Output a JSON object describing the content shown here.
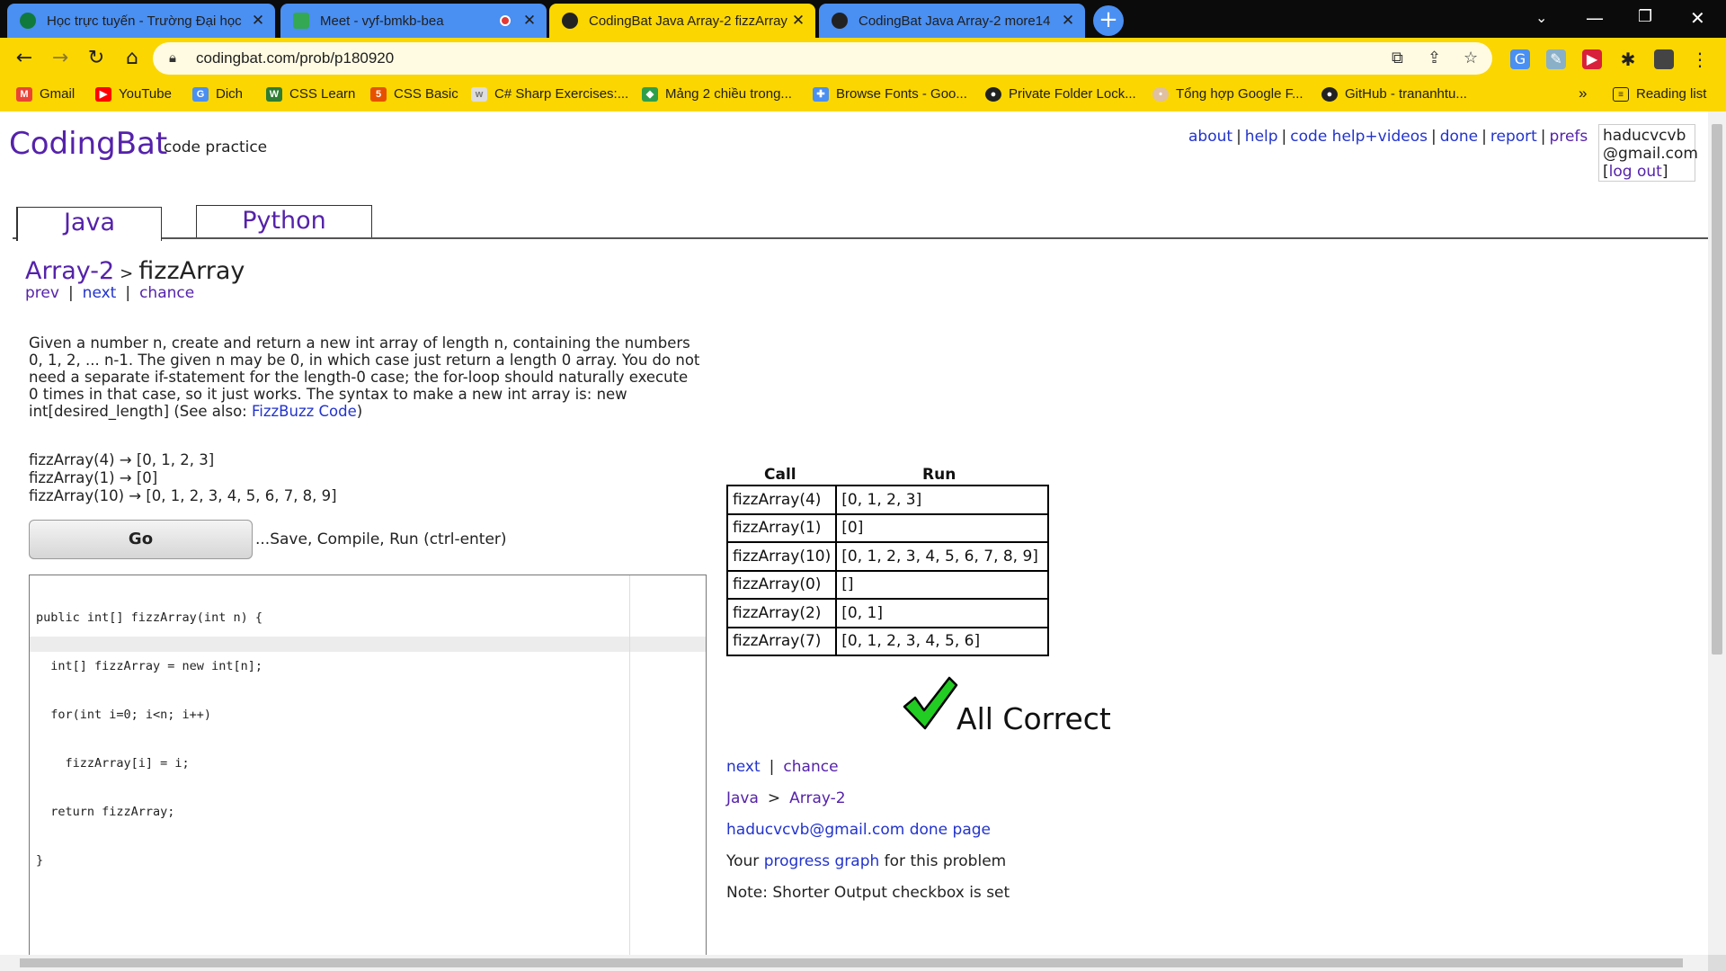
{
  "browser": {
    "tabs": [
      {
        "label": "Học trực tuyến - Trường Đại học",
        "close": "✕"
      },
      {
        "label": "Meet - vyf-bmkb-bea",
        "close": "✕"
      },
      {
        "label": "CodingBat Java Array-2 fizzArray",
        "close": "✕"
      },
      {
        "label": "CodingBat Java Array-2 more14",
        "close": "✕"
      }
    ],
    "new_tab": "+",
    "url": "codingbat.com/prob/p180920",
    "bookmarks": [
      {
        "label": "Gmail"
      },
      {
        "label": "YouTube"
      },
      {
        "label": "Dich"
      },
      {
        "label": "CSS Learn"
      },
      {
        "label": "CSS Basic"
      },
      {
        "label": "C# Sharp Exercises:..."
      },
      {
        "label": "Mảng 2 chiều trong..."
      },
      {
        "label": "Browse Fonts - Goo..."
      },
      {
        "label": "Private Folder Lock..."
      },
      {
        "label": "Tổng hợp Google F..."
      },
      {
        "label": "GitHub - trananhtu..."
      }
    ],
    "bookmarks_more": "»",
    "reading_list": "Reading list"
  },
  "site": {
    "logo": "CodingBat",
    "logo_sub": "code practice",
    "top_links": [
      "about",
      "help",
      "code help+videos",
      "done",
      "report",
      "prefs"
    ],
    "user": {
      "line1": "haducvcvb",
      "line2": "@gmail.com",
      "logout_open": "[",
      "logout": "log out",
      "logout_close": "]"
    },
    "lang_tabs": [
      "Java",
      "Python"
    ]
  },
  "problem": {
    "category": "Array-2",
    "separator": ">",
    "name": "fizzArray",
    "nav": [
      "prev",
      "next",
      "chance"
    ],
    "description": "Given a number n, create and return a new int array of length n, containing the numbers 0, 1, 2, ... n-1. The given n may be 0, in which case just return a length 0 array. You do not need a separate if-statement for the length-0 case; the for-loop should naturally execute 0 times in that case, so it just works. The syntax to make a new int array is: new int[desired_length]   (See also: ",
    "see_also_link": "FizzBuzz Code",
    "see_also_close": ")",
    "examples": [
      "fizzArray(4) → [0, 1, 2, 3]",
      "fizzArray(1) → [0]",
      "fizzArray(10) → [0, 1, 2, 3, 4, 5, 6, 7, 8, 9]"
    ],
    "go_label": "Go",
    "go_hint": "...Save, Compile, Run (ctrl-enter)"
  },
  "editor": {
    "code_lines": [
      "public int[] fizzArray(int n) {",
      "  int[] fizzArray = new int[n];",
      "  for(int i=0; i<n; i++)",
      "    fizzArray[i] = i;",
      "  return fizzArray;",
      "}"
    ]
  },
  "results": {
    "col_call": "Call",
    "col_run": "Run",
    "rows": [
      {
        "call": "fizzArray(4)",
        "run": "[0, 1, 2, 3]"
      },
      {
        "call": "fizzArray(1)",
        "run": "[0]"
      },
      {
        "call": "fizzArray(10)",
        "run": "[0, 1, 2, 3, 4, 5, 6, 7, 8, 9]"
      },
      {
        "call": "fizzArray(0)",
        "run": "[]"
      },
      {
        "call": "fizzArray(2)",
        "run": "[0, 1]"
      },
      {
        "call": "fizzArray(7)",
        "run": "[0, 1, 2, 3, 4, 5, 6]"
      }
    ],
    "status": "All Correct",
    "check_icon": "check-mark-icon"
  },
  "after": {
    "nav": [
      "next",
      "chance"
    ],
    "crumb": [
      "Java",
      ">",
      "Array-2"
    ],
    "done_page": "haducvcvb@gmail.com done page",
    "progress_prefix": "Your ",
    "progress_link": "progress graph",
    "progress_suffix": " for this problem",
    "note": "Note: Shorter Output checkbox is set"
  },
  "colors": {
    "chrome_yellow": "#fbd600",
    "tab_blue": "#4a8ff2",
    "link_purple": "#5522aa",
    "link_blue": "#2233cc",
    "check_green": "#22cc22"
  }
}
